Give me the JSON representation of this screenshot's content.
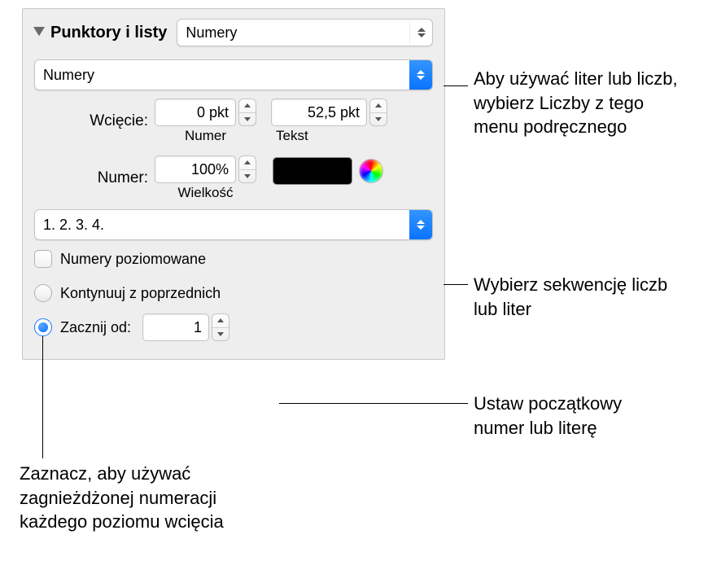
{
  "header": {
    "title": "Punktory i listy",
    "main_popup": "Numery"
  },
  "style_popup": "Numery",
  "indent": {
    "label": "Wcięcie:",
    "number_value": "0 pkt",
    "number_caption": "Numer",
    "text_value": "52,5 pkt",
    "text_caption": "Tekst"
  },
  "size": {
    "label": "Numer:",
    "value": "100%",
    "caption": "Wielkość"
  },
  "sequence_popup": "1. 2. 3. 4.",
  "tiered": "Numery poziomowane",
  "continue": "Kontynuuj z poprzednich",
  "start": {
    "label": "Zacznij od:",
    "value": "1"
  },
  "callouts": {
    "c1": "Aby używać liter lub liczb, wybierz Liczby z tego menu podręcznego",
    "c2": "Wybierz sekwencję liczb lub liter",
    "c3": "Ustaw początkowy numer lub literę",
    "c4": "Zaznacz, aby używać zagnieżdżonej numeracji każdego poziomu wcięcia"
  }
}
